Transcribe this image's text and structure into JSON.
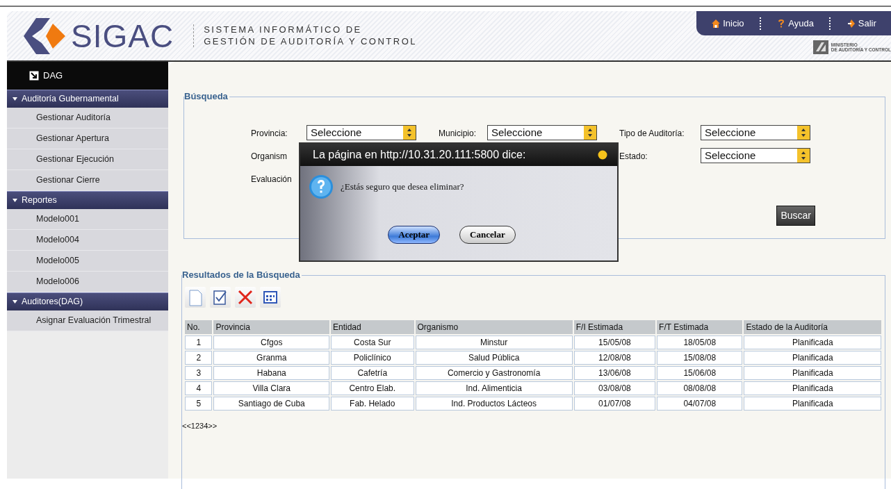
{
  "header": {
    "logo_text": "SIGAC",
    "subtitle": [
      "SISTEMA INFORMÁTICO DE",
      "GESTIÓN DE AUDITORÍA Y CONTROL"
    ],
    "nav": [
      {
        "label": "Inicio",
        "kind": "home"
      },
      {
        "label": "Ayuda",
        "kind": "help"
      },
      {
        "label": "Salir",
        "kind": "exit"
      }
    ],
    "ministry": [
      "MINISTERIO",
      "DE AUDITORÍA Y CONTROL"
    ]
  },
  "sidebar": {
    "top": "DAG",
    "sections": [
      {
        "title": "Auditoría Gubernamental",
        "expanded": true,
        "items": [
          "Gestionar Auditoría",
          "Gestionar Apertura",
          "Gestionar Ejecución",
          "Gestionar Cierre"
        ]
      },
      {
        "title": "Reportes",
        "expanded": true,
        "items": [
          "Modelo001",
          "Modelo004",
          "Modelo005",
          "Modelo006"
        ]
      },
      {
        "title": "Auditores(DAG)",
        "expanded": true,
        "items": [
          "Asignar Evaluación Trimestral"
        ]
      }
    ]
  },
  "search": {
    "legend": "Búsqueda",
    "rows": [
      {
        "fields": [
          {
            "label": "Provincia:",
            "value": "Seleccione"
          },
          {
            "label": "Municipio:",
            "value": "Seleccione"
          },
          {
            "label": "Tipo de Auditoría:",
            "value": "Seleccione"
          }
        ]
      },
      {
        "fields": [
          {
            "label": "Organism"
          },
          {
            "label": "Estado:",
            "value": "Seleccione"
          }
        ]
      },
      {
        "fields": [
          {
            "label": "Evaluación"
          }
        ]
      }
    ],
    "button": "Buscar"
  },
  "results": {
    "legend": "Resultados de la Búsqueda",
    "table": {
      "columns": [
        "No.",
        "Provincia",
        "Entidad",
        "Organismo",
        "F/I Estimada",
        "F/T Estimada",
        "Estado de la Auditoría"
      ],
      "rows": [
        [
          "1",
          "Cfgos",
          "Costa Sur",
          "Minstur",
          "15/05/08",
          "18/05/08",
          "Planificada"
        ],
        [
          "2",
          "Granma",
          "Policlínico",
          "Salud Pública",
          "12/08/08",
          "15/08/08",
          "Planificada"
        ],
        [
          "3",
          "Habana",
          "Cafetría",
          "Comercio y Gastronomía",
          "13/06/08",
          "15/06/08",
          "Planificada"
        ],
        [
          "4",
          "Villa Clara",
          "Centro Elab.",
          "Ind. Alimenticia",
          "03/08/08",
          "08/08/08",
          "Planificada"
        ],
        [
          "5",
          "Santiago de Cuba",
          "Fab. Helado",
          "Ind. Productos Lácteos",
          "01/07/08",
          "04/07/08",
          "Planificada"
        ]
      ]
    },
    "pagination": "<<1234>>"
  },
  "dialog": {
    "title": "La página en http://10.31.20.111:5800 dice:",
    "message": "¿Estás seguro que desea eliminar?",
    "buttons": [
      {
        "label": "Aceptar",
        "selected": true
      },
      {
        "label": "Cancelar",
        "selected": false
      }
    ]
  }
}
